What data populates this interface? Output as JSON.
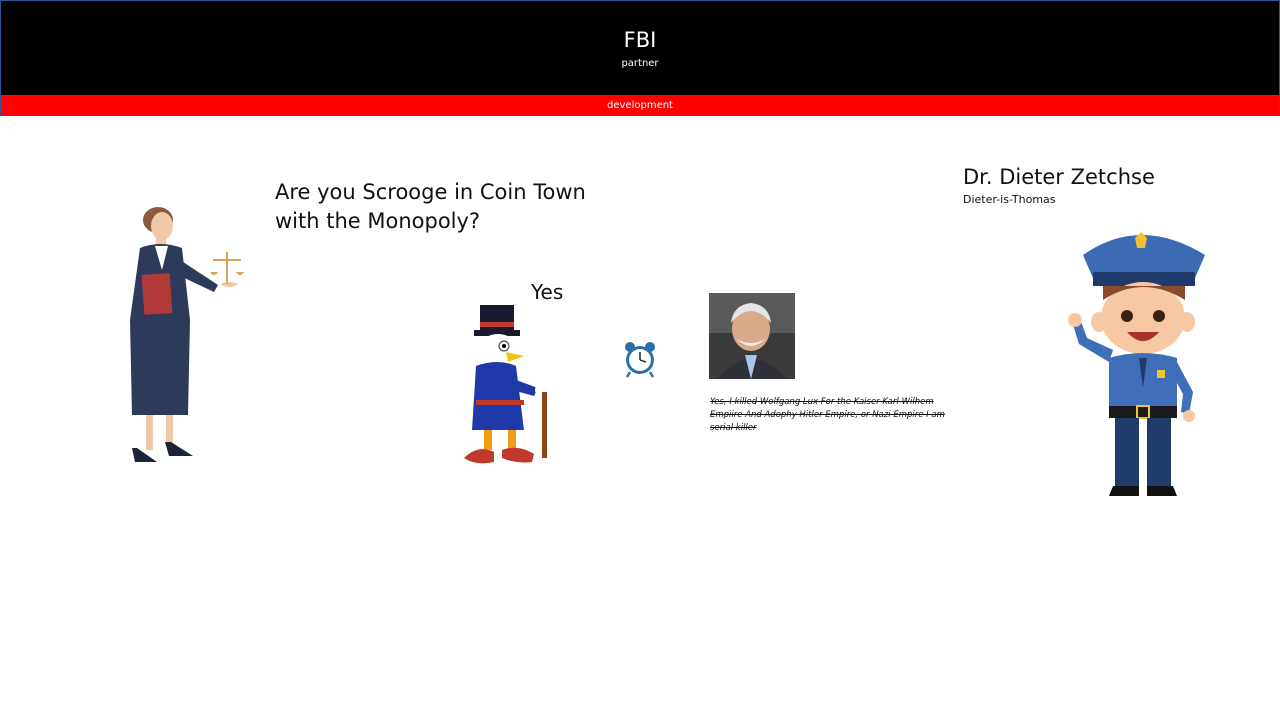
{
  "header": {
    "title": "FBI",
    "subtitle": "partner"
  },
  "banner": {
    "label": "development"
  },
  "question": "Are you Scrooge in Coin Town with the Monopoly?",
  "answer": "Yes",
  "person": {
    "name": "Dr. Dieter Zetchse",
    "alias": "Dieter-is-Thomas",
    "statement": "Yes, I killed Wolfgang Lux For the Kaiser Karl-Wilhem Empiire And Adophy Hitler Empire, or Nazi Empire I am serial killer"
  },
  "colors": {
    "header_bg": "#000000",
    "banner_bg": "#ff0000",
    "border": "#2f5597"
  },
  "icons": [
    "judge-illustration",
    "scrooge-duck-illustration",
    "alarm-clock-icon",
    "portrait-photo",
    "police-officer-illustration"
  ]
}
